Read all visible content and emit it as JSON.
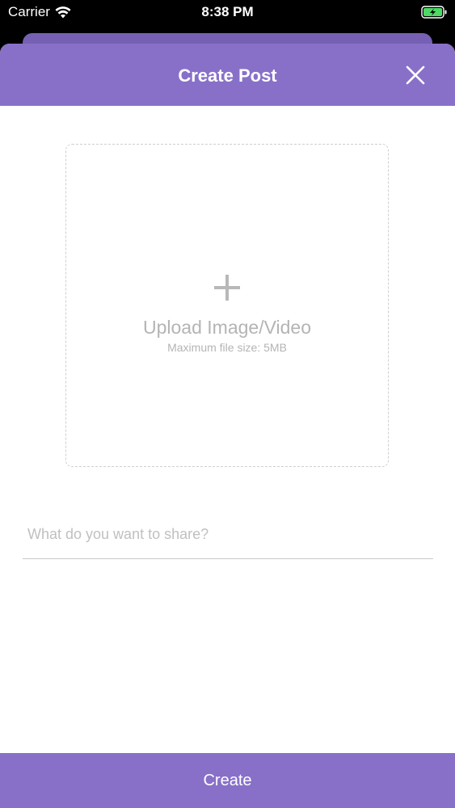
{
  "status_bar": {
    "carrier": "Carrier",
    "time": "8:38 PM",
    "battery_icon": "battery-charging-icon",
    "wifi_icon": "wifi-icon"
  },
  "header": {
    "title": "Create Post",
    "close_icon": "close-icon"
  },
  "upload": {
    "icon": "plus-icon",
    "label": "Upload Image/Video",
    "hint": "Maximum file size: 5MB"
  },
  "share": {
    "placeholder": "What do you want to share?",
    "value": ""
  },
  "footer": {
    "create_label": "Create"
  },
  "colors": {
    "accent": "#8870c9",
    "accent_dark": "#7560b3",
    "battery_green": "#4cd964"
  }
}
